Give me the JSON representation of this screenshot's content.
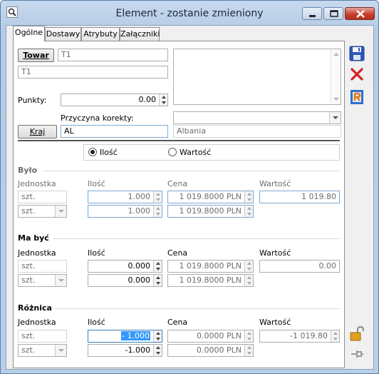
{
  "window": {
    "title": "Element - zostanie zmieniony"
  },
  "tabs": [
    {
      "label": "Ogólne"
    },
    {
      "label": "Dostawy"
    },
    {
      "label": "Atrybuty"
    },
    {
      "label": "Załączniki"
    }
  ],
  "top": {
    "towar_button": "Towar",
    "towar_code": "T1",
    "towar_name": "T1",
    "punkty_label": "Punkty:",
    "punkty_value": "0.00",
    "przyczyna_label": "Przyczyna korekty:",
    "przyczyna_value": "",
    "kraj_button": "Kraj",
    "kraj_code": "AL",
    "kraj_name": "Albania"
  },
  "mode": {
    "ilosc_label": "Ilość",
    "wartosc_label": "Wartość",
    "selected": "Ilość"
  },
  "sections": {
    "bylo": {
      "title": "Było",
      "col_jednostka": "Jednostka",
      "col_ilosc": "Ilość",
      "col_cena": "Cena",
      "col_wartosc": "Wartość",
      "row1": {
        "unit": "szt.",
        "qty": "1.000",
        "price": "1 019.8000 PLN",
        "value": "1 019.80"
      },
      "row2": {
        "unit": "szt.",
        "qty": "1.000",
        "price": "1 019.8000 PLN"
      }
    },
    "ma_byc": {
      "title": "Ma być",
      "col_jednostka": "Jednostka",
      "col_ilosc": "Ilość",
      "col_cena": "Cena",
      "col_wartosc": "Wartość",
      "row1": {
        "unit": "szt.",
        "qty": "0.000",
        "price": "1 019.8000 PLN",
        "value": "0.00"
      },
      "row2": {
        "unit": "szt.",
        "qty": "0.000",
        "price": "1 019.8000 PLN"
      }
    },
    "roznica": {
      "title": "Różnica",
      "col_jednostka": "Jednostka",
      "col_ilosc": "Ilość",
      "col_cena": "Cena",
      "col_wartosc": "Wartość",
      "row1": {
        "unit": "szt.",
        "qty_selected": "- 1.000",
        "price": "0.0000 PLN",
        "value": "-1 019.80"
      },
      "row2": {
        "unit": "szt.",
        "qty": "-1.000",
        "price": "0.0000 PLN"
      }
    }
  },
  "icons": {
    "save": "save-icon",
    "delete": "delete-icon",
    "refresh": "refresh-icon",
    "lock": "lock-icon",
    "pin": "pin-icon"
  },
  "colors": {
    "accent": "#3399ff",
    "delete": "#d42020",
    "title_bar": "#b9cfe8",
    "close": "#c7402f"
  }
}
